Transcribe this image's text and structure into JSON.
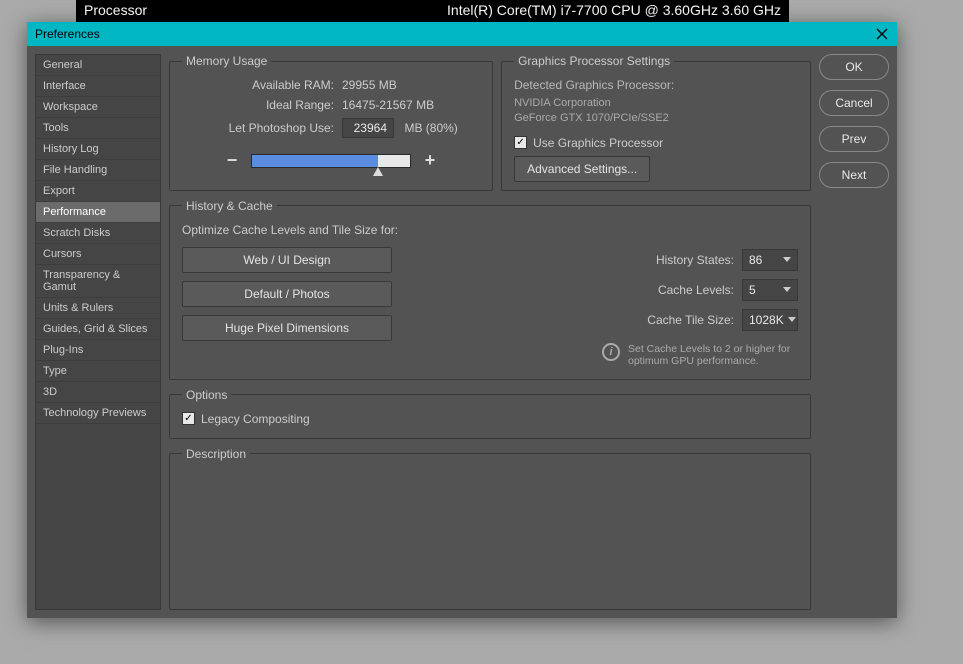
{
  "behind": {
    "left": "Processor",
    "right": "Intel(R) Core(TM) i7-7700 CPU @ 3.60GHz   3.60 GHz"
  },
  "dialog_title": "Preferences",
  "sidebar": {
    "items": [
      "General",
      "Interface",
      "Workspace",
      "Tools",
      "History Log",
      "File Handling",
      "Export",
      "Performance",
      "Scratch Disks",
      "Cursors",
      "Transparency & Gamut",
      "Units & Rulers",
      "Guides, Grid & Slices",
      "Plug-Ins",
      "Type",
      "3D",
      "Technology Previews"
    ],
    "selected_index": 7
  },
  "memory": {
    "legend": "Memory Usage",
    "available_label": "Available RAM:",
    "available_value": "29955 MB",
    "ideal_label": "Ideal Range:",
    "ideal_value": "16475-21567 MB",
    "let_label": "Let Photoshop Use:",
    "let_value": "23964",
    "unit_pct": "MB (80%)",
    "minus": "−",
    "plus": "+"
  },
  "gpu": {
    "legend": "Graphics Processor Settings",
    "detected_label": "Detected Graphics Processor:",
    "vendor": "NVIDIA Corporation",
    "model": "GeForce GTX 1070/PCIe/SSE2",
    "use_label": "Use Graphics Processor",
    "advanced_btn": "Advanced Settings..."
  },
  "history": {
    "legend": "History & Cache",
    "optimize_label": "Optimize Cache Levels and Tile Size for:",
    "btn_web": "Web / UI Design",
    "btn_default": "Default / Photos",
    "btn_huge": "Huge Pixel Dimensions",
    "states_label": "History States:",
    "states_value": "86",
    "levels_label": "Cache Levels:",
    "levels_value": "5",
    "tile_label": "Cache Tile Size:",
    "tile_value": "1028K",
    "tip": "Set Cache Levels to 2 or higher for optimum GPU performance."
  },
  "options": {
    "legend": "Options",
    "legacy_label": "Legacy Compositing"
  },
  "description": {
    "legend": "Description"
  },
  "buttons": {
    "ok": "OK",
    "cancel": "Cancel",
    "prev": "Prev",
    "next": "Next"
  }
}
